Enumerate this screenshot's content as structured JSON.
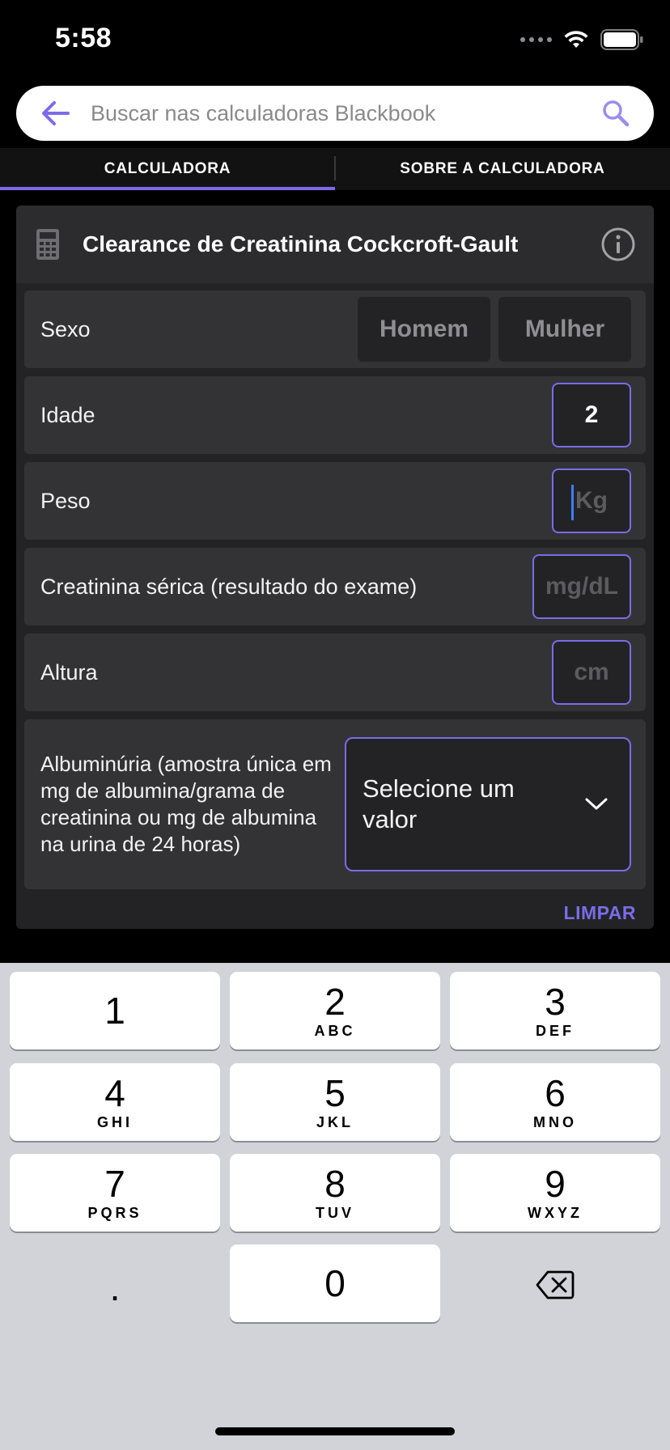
{
  "status_bar": {
    "time": "5:58"
  },
  "search": {
    "placeholder": "Buscar nas calculadoras Blackbook",
    "value": ""
  },
  "tabs": [
    {
      "label": "CALCULADORA",
      "active": true
    },
    {
      "label": "SOBRE A CALCULADORA",
      "active": false
    }
  ],
  "calculator": {
    "title": "Clearance de Creatinina Cockcroft-Gault",
    "fields": {
      "sex": {
        "label": "Sexo",
        "options": [
          "Homem",
          "Mulher"
        ]
      },
      "age": {
        "label": "Idade",
        "value": "2"
      },
      "weight": {
        "label": "Peso",
        "placeholder": "Kg"
      },
      "creatinine": {
        "label": "Creatinina sérica (resultado do exame)",
        "placeholder": "mg/dL"
      },
      "height": {
        "label": "Altura",
        "placeholder": "cm"
      },
      "albuminuria": {
        "label": "Albuminúria (amostra única em mg de albumina/grama de creatinina ou mg de albumina na urina de 24 horas)",
        "select_text": "Selecione um valor"
      }
    },
    "clear_label": "LIMPAR"
  },
  "keyboard": {
    "keys": [
      {
        "digit": "1",
        "letters": ""
      },
      {
        "digit": "2",
        "letters": "ABC"
      },
      {
        "digit": "3",
        "letters": "DEF"
      },
      {
        "digit": "4",
        "letters": "GHI"
      },
      {
        "digit": "5",
        "letters": "JKL"
      },
      {
        "digit": "6",
        "letters": "MNO"
      },
      {
        "digit": "7",
        "letters": "PQRS"
      },
      {
        "digit": "8",
        "letters": "TUV"
      },
      {
        "digit": "9",
        "letters": "WXYZ"
      },
      {
        "digit": ".",
        "letters": ""
      },
      {
        "digit": "0",
        "letters": ""
      }
    ]
  },
  "colors": {
    "accent": "#7c6be8",
    "background": "#000000",
    "card": "#232325"
  }
}
